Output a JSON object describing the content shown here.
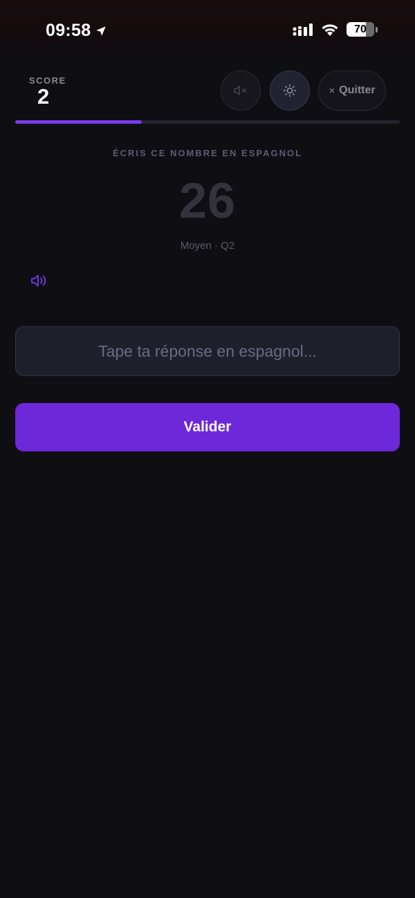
{
  "status_bar": {
    "time": "09:58",
    "battery": "70"
  },
  "header": {
    "score_label": "SCORE",
    "score_value": "2",
    "quit_label": "Quitter",
    "progress_fraction": 0.33
  },
  "question": {
    "prompt": "ÉCRIS CE NOMBRE EN ESPAGNOL",
    "number": "26",
    "meta": "Moyen · Q2"
  },
  "answer": {
    "value": "",
    "placeholder": "Tape ta réponse en espagnol..."
  },
  "actions": {
    "submit_label": "Valider"
  },
  "colors": {
    "accent": "#6d28d9",
    "background": "#0f0e13"
  },
  "icons": {
    "location": "location-arrow-icon",
    "signal": "cellular-signal-icon",
    "wifi": "wifi-icon",
    "mute": "speaker-muted-icon",
    "theme": "sun-icon",
    "audio": "speaker-icon"
  }
}
